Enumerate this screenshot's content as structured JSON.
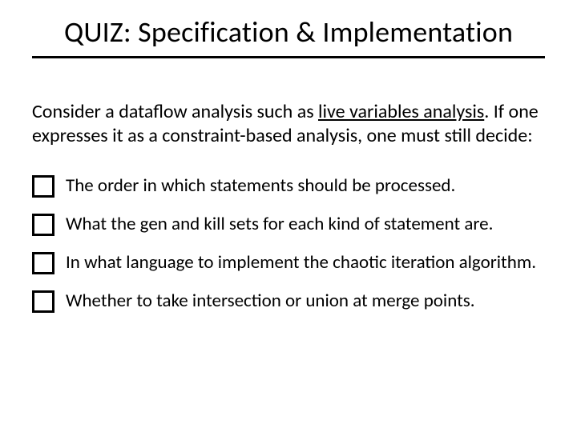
{
  "title": "QUIZ: Specification & Implementation",
  "prompt": {
    "pre": "Consider a dataflow analysis such as ",
    "underlined": "live variables analysis",
    "post": ". If one expresses it as a constraint-based analysis, one must still decide:"
  },
  "options": [
    {
      "label": "The order in which statements should be processed."
    },
    {
      "label": "What the gen and kill sets for each kind of statement are."
    },
    {
      "label": "In what language to implement the chaotic iteration algorithm."
    },
    {
      "label": "Whether to take intersection or union at merge points."
    }
  ]
}
